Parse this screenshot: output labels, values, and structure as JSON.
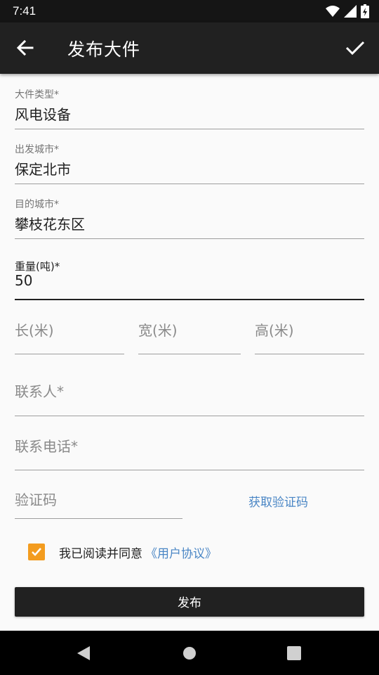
{
  "status": {
    "time": "7:41"
  },
  "appbar": {
    "title": "发布大件"
  },
  "form": {
    "cargo_type": {
      "label": "大件类型*",
      "value": "风电设备"
    },
    "from_city": {
      "label": "出发城市*",
      "value": "保定北市"
    },
    "to_city": {
      "label": "目的城市*",
      "value": "攀枝花东区"
    },
    "weight": {
      "label": "重量(吨)*",
      "value": "50"
    },
    "length": {
      "placeholder": "长(米)"
    },
    "width": {
      "placeholder": "宽(米)"
    },
    "height": {
      "placeholder": "高(米)"
    },
    "contact": {
      "placeholder": "联系人*"
    },
    "phone": {
      "placeholder": "联系电话*"
    },
    "code": {
      "placeholder": "验证码"
    },
    "get_code": "获取验证码"
  },
  "agreement": {
    "checked": true,
    "text": "我已阅读并同意",
    "link": "《用户协议》"
  },
  "submit_label": "发布",
  "colors": {
    "app_bar": "#212121",
    "accent_link": "#4a86c5",
    "checkbox": "#f39c1f"
  },
  "icons": {
    "back": "arrow-left-icon",
    "confirm": "check-icon",
    "wifi": "wifi-icon",
    "signal": "signal-icon",
    "battery": "battery-icon",
    "nav_back": "triangle-back-icon",
    "nav_home": "circle-home-icon",
    "nav_recent": "square-recent-icon"
  }
}
